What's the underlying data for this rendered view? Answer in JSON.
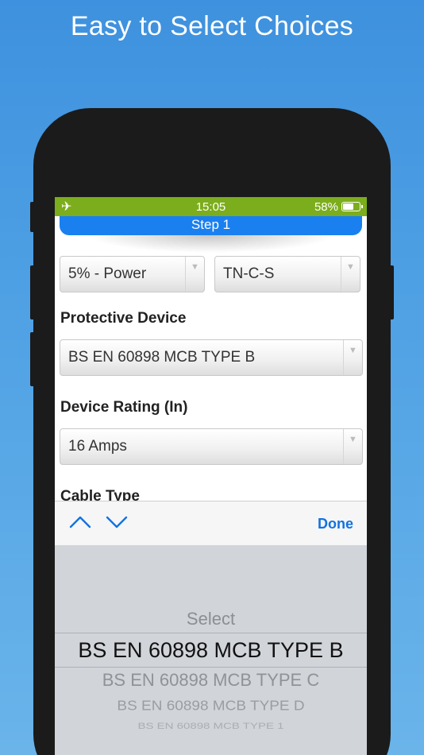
{
  "headline": "Easy to Select Choices",
  "status_bar": {
    "time": "15:05",
    "battery": "58%",
    "battery_level": 0.58
  },
  "step": {
    "title": "Step 1"
  },
  "form": {
    "selects": {
      "voltage_drop": "5% - Power",
      "earthing": "TN-C-S",
      "protective_device": "BS EN 60898 MCB TYPE B",
      "device_rating": "16 Amps"
    },
    "labels": {
      "protective_device": "Protective Device",
      "device_rating": "Device Rating (In)",
      "cable_type": "Cable Type"
    }
  },
  "toolbar": {
    "done": "Done"
  },
  "picker": {
    "options": [
      "Select",
      "BS EN 60898 MCB TYPE B",
      "BS EN 60898 MCB TYPE C",
      "BS EN 60898 MCB TYPE D",
      "BS EN 60898 MCB TYPE 1"
    ],
    "selected": "BS EN 60898 MCB TYPE B"
  },
  "colors": {
    "status_bar": "#7cad1c",
    "step_bar": "#1a80f0",
    "accent": "#1273e0",
    "background": "#4a9ce2"
  }
}
